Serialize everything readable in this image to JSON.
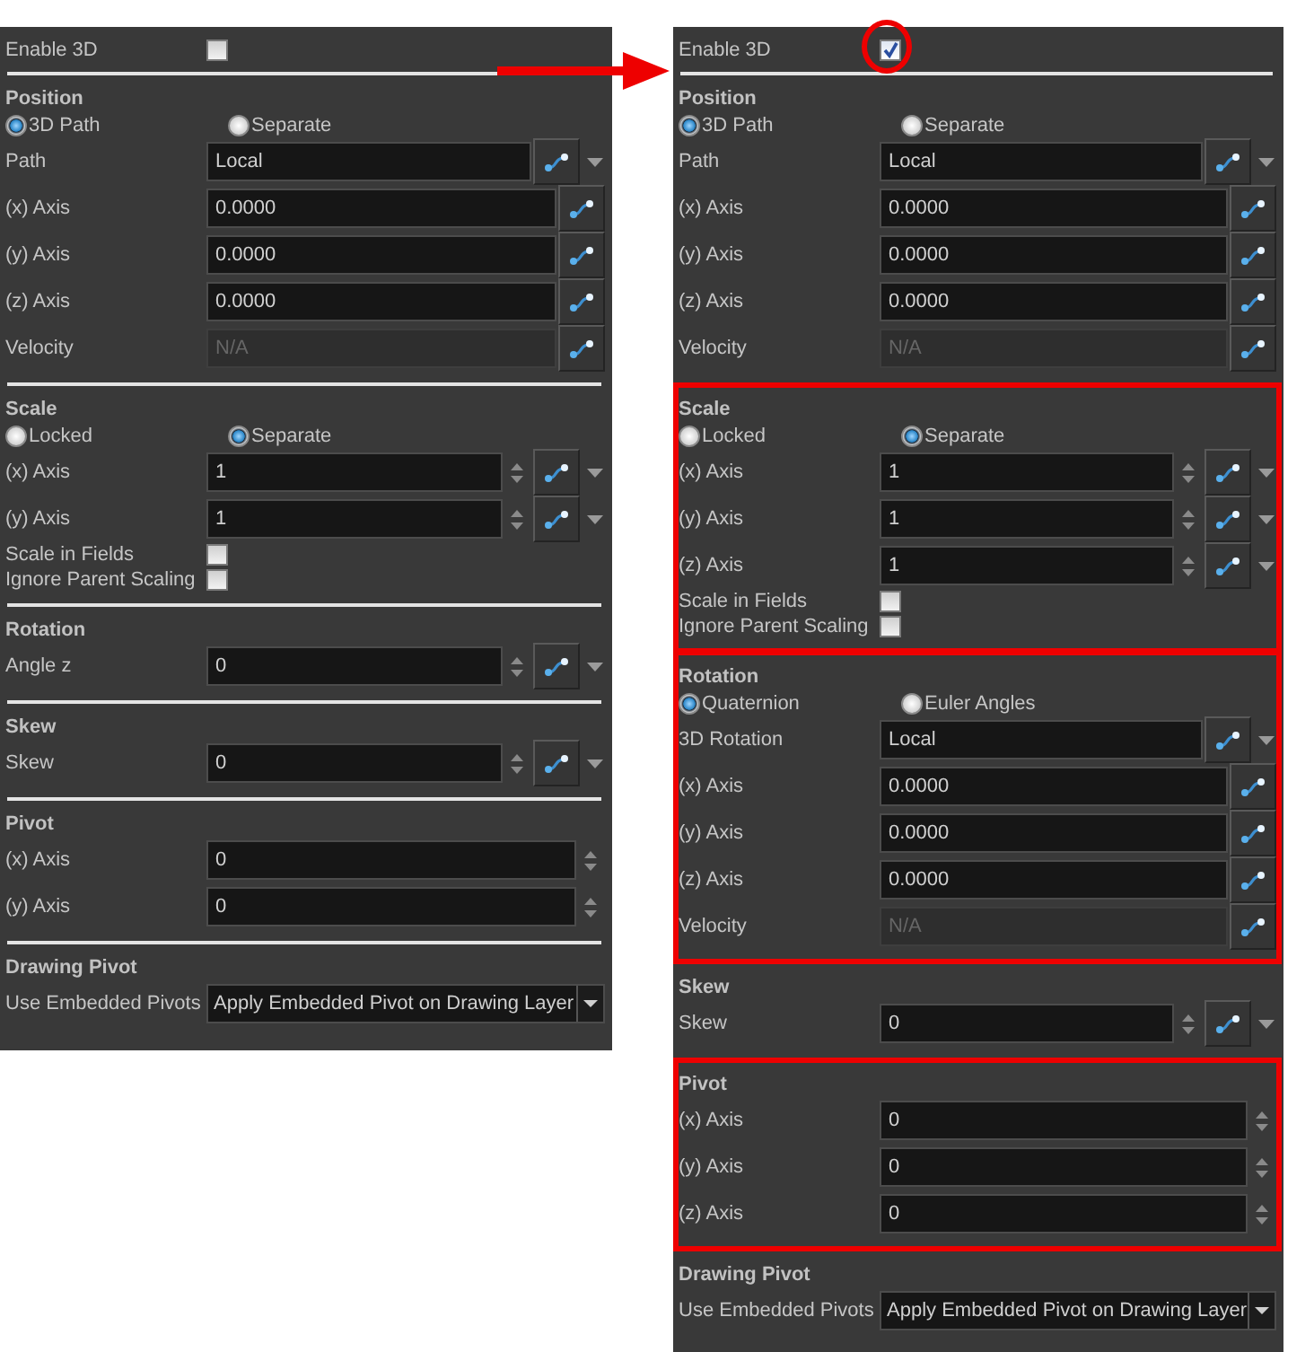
{
  "panels": [
    {
      "enable_3d": {
        "label": "Enable 3D",
        "checked": false,
        "circled": false
      },
      "sections": [
        {
          "title": "Position",
          "highlighted": false,
          "radios": [
            {
              "label": "3D Path",
              "selected": true
            },
            {
              "label": "Separate",
              "selected": false
            }
          ],
          "rows": [
            {
              "kind": "field",
              "label": "Path",
              "value": "Local",
              "disabled": false,
              "spinner": false,
              "curve_button": true,
              "menu_arrow": true
            },
            {
              "kind": "field",
              "label": "(x) Axis",
              "value": "0.0000",
              "disabled": false,
              "spinner": false,
              "curve_button": true,
              "menu_arrow": false
            },
            {
              "kind": "field",
              "label": "(y) Axis",
              "value": "0.0000",
              "disabled": false,
              "spinner": false,
              "curve_button": true,
              "menu_arrow": false
            },
            {
              "kind": "field",
              "label": "(z) Axis",
              "value": "0.0000",
              "disabled": false,
              "spinner": false,
              "curve_button": true,
              "menu_arrow": false
            },
            {
              "kind": "field",
              "label": "Velocity",
              "value": "N/A",
              "disabled": true,
              "spinner": false,
              "curve_button": true,
              "menu_arrow": false
            }
          ]
        },
        {
          "title": "Scale",
          "highlighted": false,
          "radios": [
            {
              "label": "Locked",
              "selected": false
            },
            {
              "label": "Separate",
              "selected": true
            }
          ],
          "rows": [
            {
              "kind": "field",
              "label": "(x) Axis",
              "value": "1",
              "disabled": false,
              "spinner": true,
              "curve_button": true,
              "menu_arrow": true
            },
            {
              "kind": "field",
              "label": "(y) Axis",
              "value": "1",
              "disabled": false,
              "spinner": true,
              "curve_button": true,
              "menu_arrow": true
            },
            {
              "kind": "check",
              "label": "Scale in Fields",
              "checked": false
            },
            {
              "kind": "check",
              "label": "Ignore Parent Scaling",
              "checked": false
            }
          ]
        },
        {
          "title": "Rotation",
          "highlighted": false,
          "rows": [
            {
              "kind": "field",
              "label": "Angle z",
              "value": "0",
              "disabled": false,
              "spinner": true,
              "curve_button": true,
              "menu_arrow": true
            }
          ]
        },
        {
          "title": "Skew",
          "highlighted": false,
          "rows": [
            {
              "kind": "field",
              "label": "Skew",
              "value": "0",
              "disabled": false,
              "spinner": true,
              "curve_button": true,
              "menu_arrow": true
            }
          ]
        },
        {
          "title": "Pivot",
          "highlighted": false,
          "rows": [
            {
              "kind": "field",
              "label": "(x) Axis",
              "value": "0",
              "disabled": false,
              "spinner": true,
              "curve_button": false,
              "menu_arrow": false
            },
            {
              "kind": "field",
              "label": "(y) Axis",
              "value": "0",
              "disabled": false,
              "spinner": true,
              "curve_button": false,
              "menu_arrow": false
            }
          ]
        },
        {
          "title": "Drawing Pivot",
          "highlighted": false,
          "rows": [
            {
              "kind": "combo",
              "label": "Use Embedded Pivots",
              "value": "Apply Embedded Pivot on Drawing Layer"
            }
          ]
        }
      ]
    },
    {
      "enable_3d": {
        "label": "Enable 3D",
        "checked": true,
        "circled": true
      },
      "sections": [
        {
          "title": "Position",
          "highlighted": false,
          "radios": [
            {
              "label": "3D Path",
              "selected": true
            },
            {
              "label": "Separate",
              "selected": false
            }
          ],
          "rows": [
            {
              "kind": "field",
              "label": "Path",
              "value": "Local",
              "disabled": false,
              "spinner": false,
              "curve_button": true,
              "menu_arrow": true
            },
            {
              "kind": "field",
              "label": "(x) Axis",
              "value": "0.0000",
              "disabled": false,
              "spinner": false,
              "curve_button": true,
              "menu_arrow": false
            },
            {
              "kind": "field",
              "label": "(y) Axis",
              "value": "0.0000",
              "disabled": false,
              "spinner": false,
              "curve_button": true,
              "menu_arrow": false
            },
            {
              "kind": "field",
              "label": "(z) Axis",
              "value": "0.0000",
              "disabled": false,
              "spinner": false,
              "curve_button": true,
              "menu_arrow": false
            },
            {
              "kind": "field",
              "label": "Velocity",
              "value": "N/A",
              "disabled": true,
              "spinner": false,
              "curve_button": true,
              "menu_arrow": false
            }
          ]
        },
        {
          "title": "Scale",
          "highlighted": true,
          "radios": [
            {
              "label": "Locked",
              "selected": false
            },
            {
              "label": "Separate",
              "selected": true
            }
          ],
          "rows": [
            {
              "kind": "field",
              "label": "(x) Axis",
              "value": "1",
              "disabled": false,
              "spinner": true,
              "curve_button": true,
              "menu_arrow": true
            },
            {
              "kind": "field",
              "label": "(y) Axis",
              "value": "1",
              "disabled": false,
              "spinner": true,
              "curve_button": true,
              "menu_arrow": true
            },
            {
              "kind": "field",
              "label": "(z) Axis",
              "value": "1",
              "disabled": false,
              "spinner": true,
              "curve_button": true,
              "menu_arrow": true
            },
            {
              "kind": "check",
              "label": "Scale in Fields",
              "checked": false
            },
            {
              "kind": "check",
              "label": "Ignore Parent Scaling",
              "checked": false
            }
          ]
        },
        {
          "title": "Rotation",
          "highlighted": true,
          "radios": [
            {
              "label": "Quaternion",
              "selected": true
            },
            {
              "label": "Euler Angles",
              "selected": false
            }
          ],
          "rows": [
            {
              "kind": "field",
              "label": "3D Rotation",
              "value": "Local",
              "disabled": false,
              "spinner": false,
              "curve_button": true,
              "menu_arrow": true
            },
            {
              "kind": "field",
              "label": "(x) Axis",
              "value": "0.0000",
              "disabled": false,
              "spinner": false,
              "curve_button": true,
              "menu_arrow": false
            },
            {
              "kind": "field",
              "label": "(y) Axis",
              "value": "0.0000",
              "disabled": false,
              "spinner": false,
              "curve_button": true,
              "menu_arrow": false
            },
            {
              "kind": "field",
              "label": "(z) Axis",
              "value": "0.0000",
              "disabled": false,
              "spinner": false,
              "curve_button": true,
              "menu_arrow": false
            },
            {
              "kind": "field",
              "label": "Velocity",
              "value": "N/A",
              "disabled": true,
              "spinner": false,
              "curve_button": true,
              "menu_arrow": false
            }
          ]
        },
        {
          "title": "Skew",
          "highlighted": false,
          "rows": [
            {
              "kind": "field",
              "label": "Skew",
              "value": "0",
              "disabled": false,
              "spinner": true,
              "curve_button": true,
              "menu_arrow": true
            }
          ]
        },
        {
          "title": "Pivot",
          "highlighted": true,
          "rows": [
            {
              "kind": "field",
              "label": "(x) Axis",
              "value": "0",
              "disabled": false,
              "spinner": true,
              "curve_button": false,
              "menu_arrow": false
            },
            {
              "kind": "field",
              "label": "(y) Axis",
              "value": "0",
              "disabled": false,
              "spinner": true,
              "curve_button": false,
              "menu_arrow": false
            },
            {
              "kind": "field",
              "label": "(z) Axis",
              "value": "0",
              "disabled": false,
              "spinner": true,
              "curve_button": false,
              "menu_arrow": false
            }
          ]
        },
        {
          "title": "Drawing Pivot",
          "highlighted": false,
          "rows": [
            {
              "kind": "combo",
              "label": "Use Embedded Pivots",
              "value": "Apply Embedded Pivot on Drawing Layer"
            }
          ]
        }
      ]
    }
  ]
}
